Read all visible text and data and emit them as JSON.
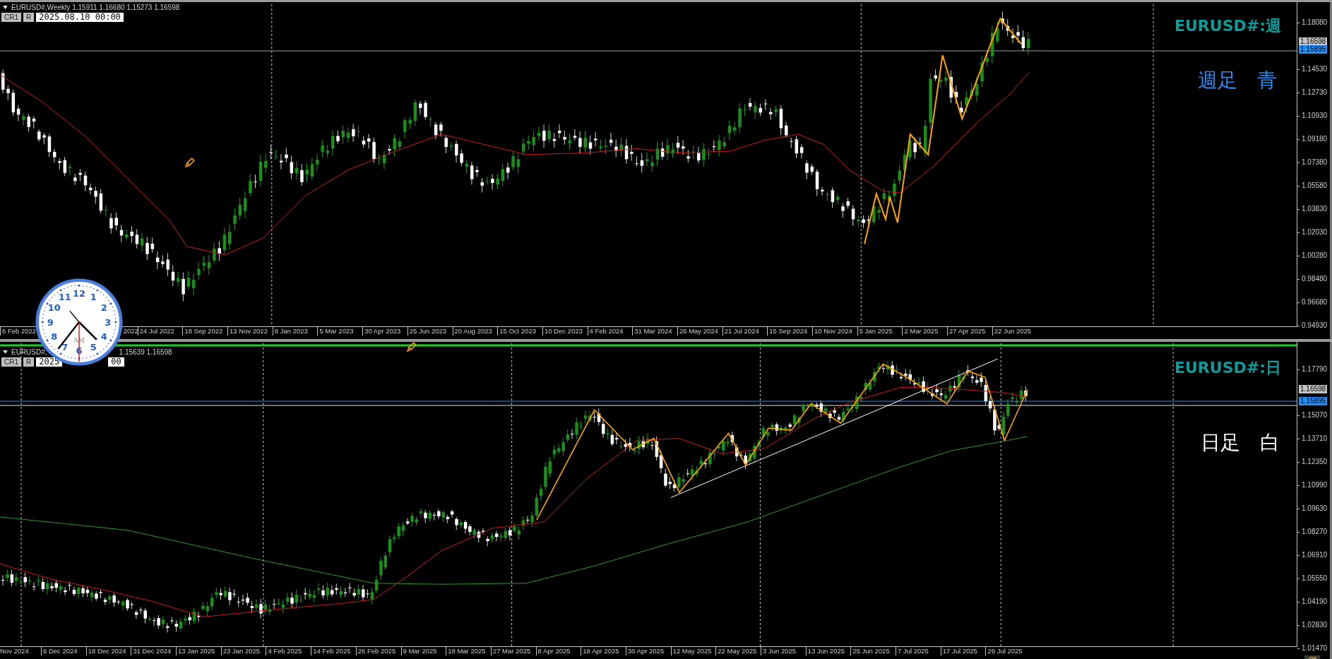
{
  "panes": [
    {
      "symbol": "EURUSD#,Weekly",
      "ohlc": "1.15911 1.16680 1.15273 1.16598",
      "buttons": [
        "CR1",
        "R"
      ],
      "date_field": [
        "2025.08.10 00:00"
      ],
      "chart_label": "EURUSD#:週",
      "note": {
        "text": "週足　青",
        "color": "#2a8cf0"
      },
      "current_price": "1.16598",
      "line_price": "1.15895",
      "price_labels": [
        "1.18080",
        "1.14530",
        "1.12730",
        "1.10930",
        "1.09180",
        "1.07380",
        "1.05580",
        "1.03830",
        "1.02030",
        "1.00280",
        "0.98480",
        "0.96680",
        "0.94930"
      ],
      "dates": [
        "6 Feb 2022",
        "2022",
        "24 Jul 2022",
        "18 Sep 2022",
        "13 Nov 2022",
        "8 Jan 2023",
        "5 Mar 2023",
        "30 Apr 2023",
        "25 Jun 2023",
        "20 Aug 2023",
        "15 Oct 2023",
        "10 Dec 2023",
        "4 Feb 2024",
        "31 Mar 2024",
        "26 May 2024",
        "21 Jul 2024",
        "15 Sep 2024",
        "10 Nov 2024",
        "5 Jan 2025",
        "2 Mar 2025",
        "27 Apr 2025",
        "22 Jun 2025"
      ]
    },
    {
      "symbol": "EURUSD#,",
      "ohlc": "1.15639 1.16598",
      "buttons": [
        "CR1",
        "R"
      ],
      "date_field": [
        "2025",
        "00"
      ],
      "chart_label": "EURUSD#:日",
      "note": {
        "text": "日足　白",
        "color": "#ffffff"
      },
      "current_price": "1.16598",
      "line_price": "1.15895",
      "price_labels": [
        "1.17790",
        "1.15070",
        "1.13710",
        "1.12350",
        "1.10990",
        "1.09630",
        "1.08270",
        "1.06910",
        "1.05550",
        "1.04190",
        "1.02830",
        "1.01470"
      ],
      "dates": [
        "Nov 2024",
        "6 Dec 2024",
        "18 Dec 2024",
        "31 Dec 2024",
        "13 Jan 2025",
        "23 Jan 2025",
        "4 Feb 2025",
        "14 Feb 2025",
        "26 Feb 2025",
        "9 Mar 2025",
        "18 Mar 2025",
        "27 Mar 2025",
        "8 Apr 2025",
        "18 Apr 2025",
        "30 Apr 2025",
        "12 May 2025",
        "22 May 2025",
        "3 Jun 2025",
        "13 Jun 2025",
        "25 Jun 2025",
        "7 Jul 2025",
        "17 Jul 2025",
        "29 Jul 2025"
      ]
    }
  ],
  "clock": {
    "numbers": [
      "12",
      "11",
      "1",
      "10",
      "2",
      "9",
      "3",
      "8",
      "4",
      "7",
      "5",
      "6"
    ],
    "meridiem": "AM"
  }
}
